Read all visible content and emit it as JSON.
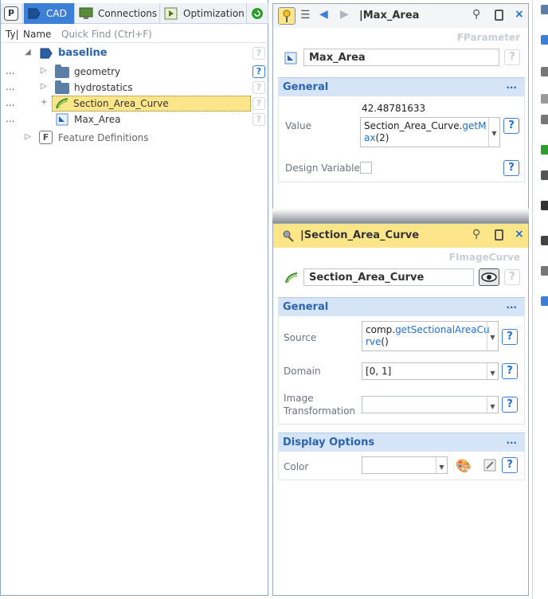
{
  "left": {
    "tabs": [
      {
        "label": "P",
        "icon": "p-icon"
      },
      {
        "label": "CAD",
        "icon": "cad-icon"
      },
      {
        "label": "Connections",
        "icon": "monitor-icon"
      },
      {
        "label": "Optimization",
        "icon": "play-icon"
      }
    ],
    "columns": {
      "type": "Ty|",
      "name": "Name",
      "quick_find_placeholder": "Quick Find (Ctrl+F)"
    },
    "tree": [
      {
        "name": "baseline",
        "level": 0
      },
      {
        "name": "geometry",
        "level": 1
      },
      {
        "name": "hydrostatics",
        "level": 1
      },
      {
        "name": "Section_Area_Curve",
        "level": 1
      },
      {
        "name": "Max_Area",
        "level": 1
      }
    ],
    "feature_definitions": "Feature Definitions",
    "dots": "...",
    "help": "?"
  },
  "param_panel": {
    "title": "|Max_Area",
    "type_label": "FParameter",
    "name_value": "Max_Area",
    "section_title": "General",
    "more": "...",
    "value_label": "Value",
    "value_result": "42.48781633",
    "value_expr_1": "Section_Area_Curve.",
    "value_expr_2": "getM",
    "value_expr_3": "ax",
    "value_expr_4": "(2)",
    "design_variable_label": "Design Variable",
    "help": "?"
  },
  "curve_panel": {
    "title": "|Section_Area_Curve",
    "type_label": "FImageCurve",
    "name_value": "Section_Area_Curve",
    "section_general": "General",
    "more": "...",
    "source_label": "Source",
    "source_1": "comp.",
    "source_2": "getSectionalAreaCu",
    "source_3": "rve",
    "source_4": "()",
    "domain_label": "Domain",
    "domain_value": "[0, 1]",
    "image_transformation_label_1": "Image",
    "image_transformation_label_2": "Transformation",
    "section_display": "Display Options",
    "color_label": "Color",
    "help": "?"
  },
  "colors": {
    "accent": "#3c7fd6",
    "selected_row": "#fde68a",
    "section_bg": "#d5e4f6"
  }
}
